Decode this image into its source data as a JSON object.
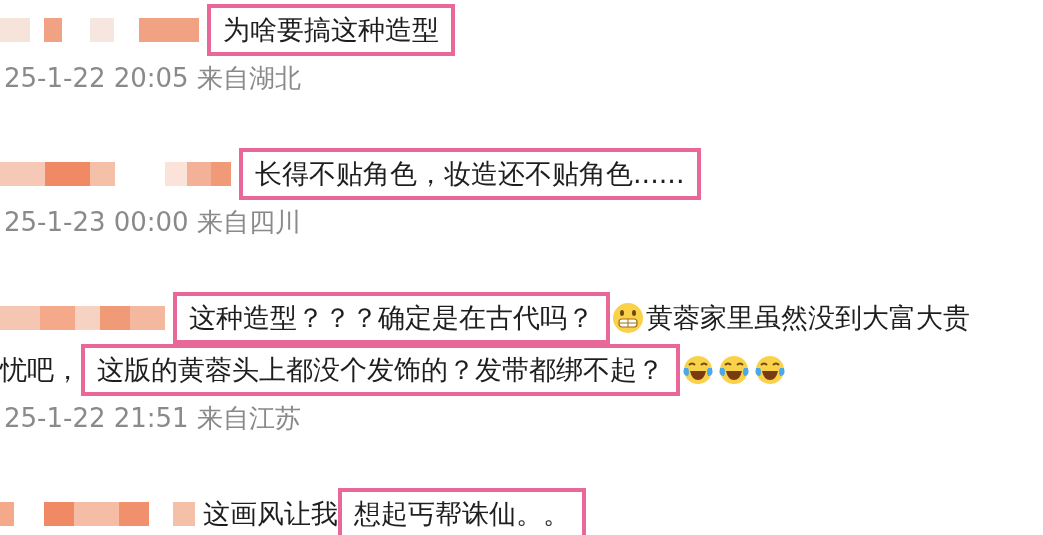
{
  "comments": [
    {
      "lines": [
        [
          {
            "kind": "text",
            "text": "为啥要搞这种造型",
            "highlighted": true
          }
        ]
      ],
      "date": "25-1-22 20:05 来自湖北"
    },
    {
      "lines": [
        [
          {
            "kind": "text",
            "text": "长得不贴角色，妆造还不贴角色......",
            "highlighted": true
          }
        ]
      ],
      "date": "25-1-23 00:00 来自四川"
    },
    {
      "lines": [
        [
          {
            "kind": "text",
            "text": "这种造型？？？确定是在古代吗？",
            "highlighted": true
          },
          {
            "kind": "grimace"
          },
          {
            "kind": "text",
            "text": "黄蓉家里虽然没到大富大贵",
            "highlighted": false
          }
        ],
        [
          {
            "kind": "text",
            "text": "忧吧，",
            "highlighted": false
          },
          {
            "kind": "text",
            "text": "这版的黄蓉头上都没个发饰的？发带都绑不起？",
            "highlighted": true
          },
          {
            "kind": "laughcry"
          },
          {
            "kind": "laughcry"
          },
          {
            "kind": "laughcry"
          }
        ]
      ],
      "date": "25-1-22 21:51 来自江苏"
    },
    {
      "lines": [
        [
          {
            "kind": "text",
            "text": "这画风让我",
            "highlighted": false
          },
          {
            "kind": "text",
            "text": "想起丐帮诛仙。。",
            "highlighted": true
          }
        ]
      ]
    }
  ]
}
